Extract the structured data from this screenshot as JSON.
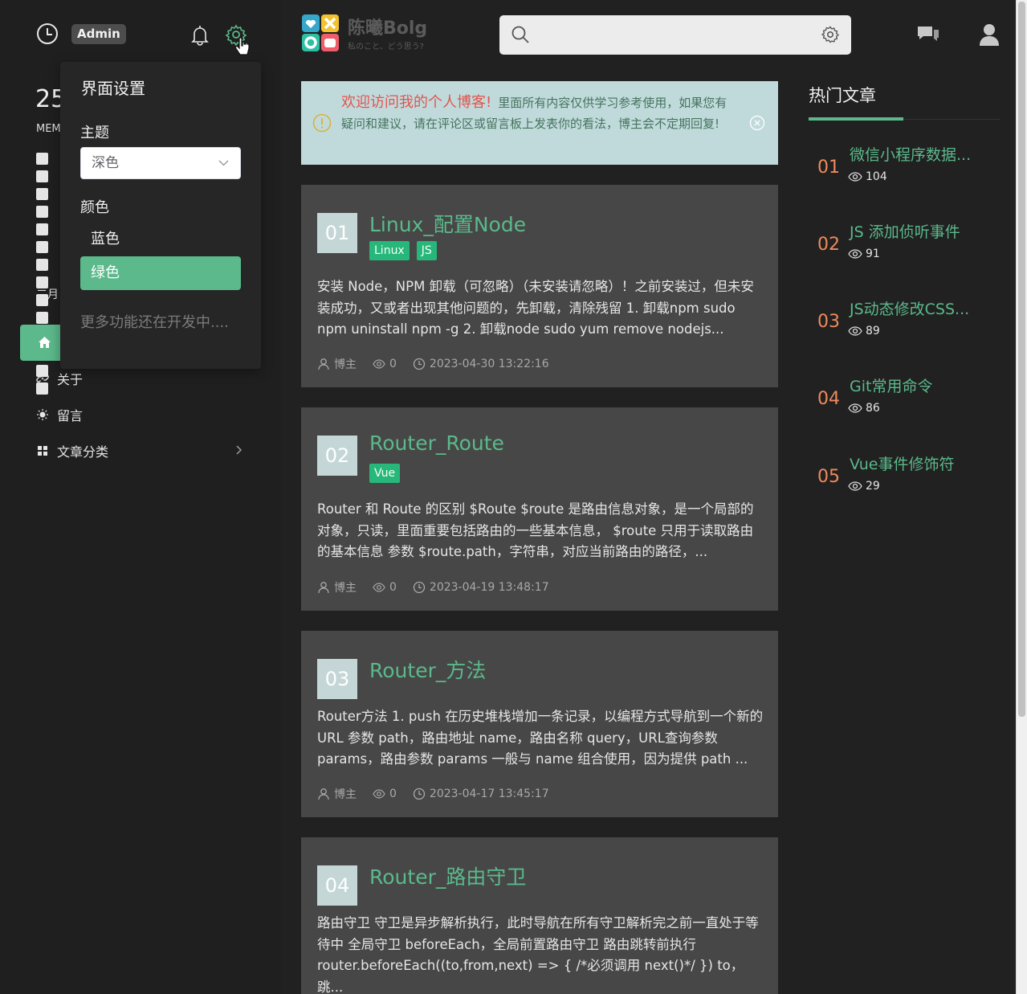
{
  "header": {
    "admin_label": "Admin",
    "logo_text": "陈曦Bolg",
    "logo_subtitle": "私のこと、どう思う?",
    "search_placeholder": ""
  },
  "sidebar": {
    "date_big": "25",
    "date_mem": "MEM",
    "month": "二月",
    "nav": [
      {
        "label": "关于",
        "icon": "link-icon"
      },
      {
        "label": "留言",
        "icon": "sun-icon"
      },
      {
        "label": "文章分类",
        "icon": "grid-icon"
      }
    ]
  },
  "settings": {
    "title": "界面设置",
    "theme_label": "主题",
    "theme_value": "深色",
    "color_label": "颜色",
    "colors": [
      "蓝色",
      "绿色"
    ],
    "active_color": "绿色",
    "more": "更多功能还在开发中...."
  },
  "notice": {
    "highlight": "欢迎访问我的个人博客!",
    "text": "里面所有内容仅供学习参考使用，如果您有疑问和建议，请在评论区或留言板上发表你的看法，博主会不定期回复!"
  },
  "posts": [
    {
      "num": "01",
      "title": "Linux_配置Node",
      "tags": [
        "Linux",
        "JS"
      ],
      "excerpt": "安装 Node，NPM 卸载（可忽略）（未安装请忽略）！之前安装过，但未安装成功，又或者出现其他问题的，先卸载，清除残留 1. 卸载npm sudo npm uninstall npm -g 2. 卸载node sudo yum remove nodejs...",
      "author": "博主",
      "views": "0",
      "date": "2023-04-30 13:22:16"
    },
    {
      "num": "02",
      "title": "Router_Route",
      "tags": [
        "Vue"
      ],
      "excerpt": "Router 和 Route 的区别 $Route $route 是路由信息对象，是一个局部的对象，只读，里面重要包括路由的一些基本信息， $route 只用于读取路由的基本信息 参数 $route.path，字符串，对应当前路由的路径，...",
      "author": "博主",
      "views": "0",
      "date": "2023-04-19 13:48:17"
    },
    {
      "num": "03",
      "title": "Router_方法",
      "tags": [],
      "excerpt": "Router方法 1. push 在历史堆栈增加一条记录，以编程方式导航到一个新的URL 参数 path，路由地址 name，路由名称 query，URL查询参数 params，路由参数 params 一般与 name 组合使用，因为提供 path ...",
      "author": "博主",
      "views": "0",
      "date": "2023-04-17 13:45:17"
    },
    {
      "num": "04",
      "title": "Router_路由守卫",
      "tags": [],
      "excerpt": "路由守卫 守卫是异步解析执行，此时导航在所有守卫解析完之前一直处于等待中 全局守卫 beforeEach，全局前置路由守卫 路由跳转前执行 router.beforeEach((to,from,next) => { /*必须调用 next()*/ }) to，跳..."
    }
  ],
  "hot": {
    "title": "热门文章",
    "items": [
      {
        "num": "01",
        "title": "微信小程序数据...",
        "views": "104"
      },
      {
        "num": "02",
        "title": "JS 添加侦听事件",
        "views": "91"
      },
      {
        "num": "03",
        "title": "JS动态修改CSS...",
        "views": "89"
      },
      {
        "num": "04",
        "title": "Git常用命令",
        "views": "86"
      },
      {
        "num": "05",
        "title": "Vue事件修饰符",
        "views": "29"
      }
    ]
  },
  "colors": {
    "accent": "#5bb98b",
    "hot_number": "#ef8a5b",
    "notice_bg": "#c0dadc",
    "notice_highlight": "#e0554d"
  }
}
